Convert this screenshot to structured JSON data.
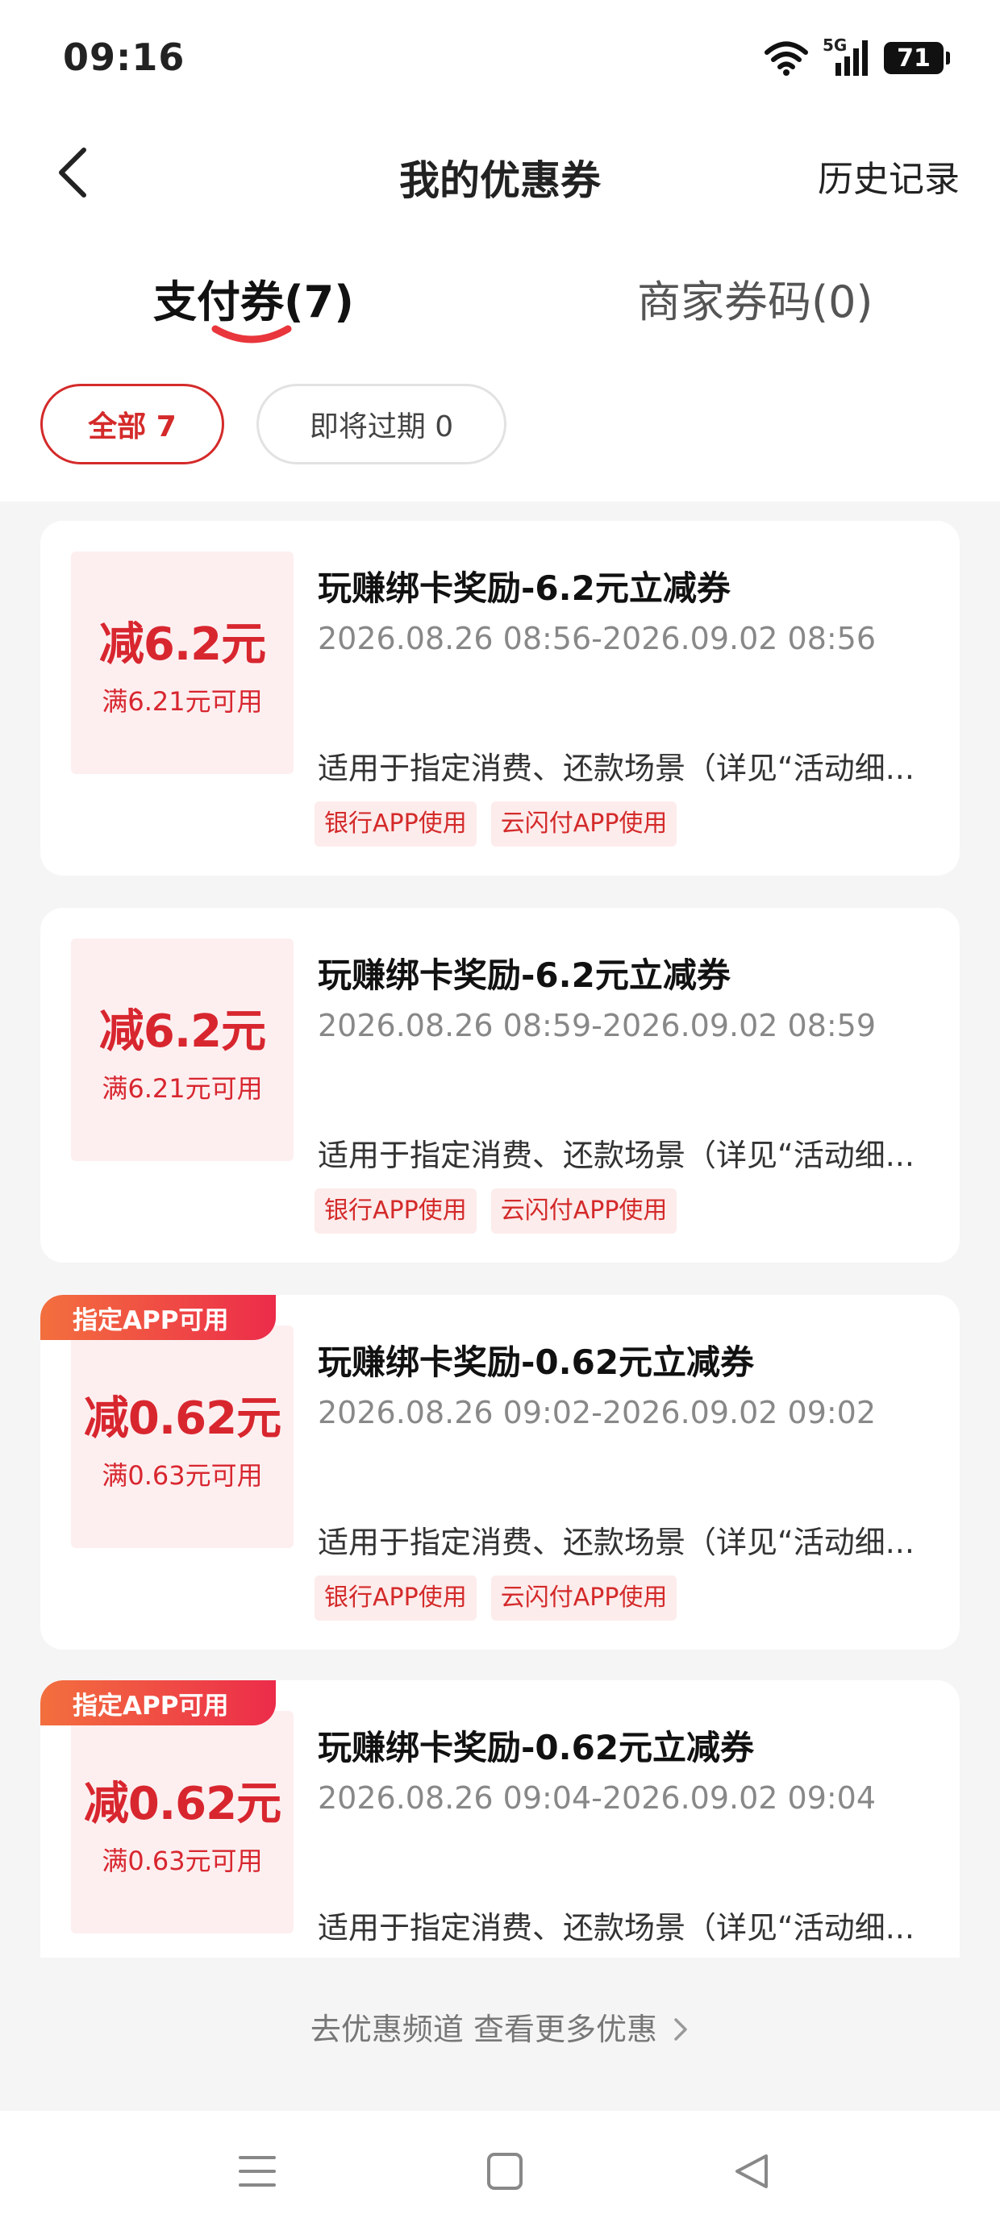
{
  "status": {
    "time": "09:16",
    "network": "5G",
    "battery": "71"
  },
  "header": {
    "title": "我的优惠券",
    "history": "历史记录"
  },
  "tabs": [
    {
      "label": "支付券(7)",
      "active": true
    },
    {
      "label": "商家券码(0)",
      "active": false
    }
  ],
  "filters": [
    {
      "label": "全部 7",
      "active": true
    },
    {
      "label": "即将过期 0",
      "active": false
    }
  ],
  "coupons": [
    {
      "ribbon": "",
      "amount": "减6.2元",
      "threshold": "满6.21元可用",
      "title": "玩赚绑卡奖励-6.2元立减券",
      "period": "2026.08.26 08:56-2026.09.02 08:56",
      "description": "适用于指定消费、还款场景（详见“活动细...",
      "tags": [
        "银行APP使用",
        "云闪付APP使用"
      ]
    },
    {
      "ribbon": "",
      "amount": "减6.2元",
      "threshold": "满6.21元可用",
      "title": "玩赚绑卡奖励-6.2元立减券",
      "period": "2026.08.26 08:59-2026.09.02 08:59",
      "description": "适用于指定消费、还款场景（详见“活动细...",
      "tags": [
        "银行APP使用",
        "云闪付APP使用"
      ]
    },
    {
      "ribbon": "指定APP可用",
      "amount": "减0.62元",
      "threshold": "满0.63元可用",
      "title": "玩赚绑卡奖励-0.62元立减券",
      "period": "2026.08.26 09:02-2026.09.02 09:02",
      "description": "适用于指定消费、还款场景（详见“活动细...",
      "tags": [
        "银行APP使用",
        "云闪付APP使用"
      ]
    },
    {
      "ribbon": "指定APP可用",
      "amount": "减0.62元",
      "threshold": "满0.63元可用",
      "title": "玩赚绑卡奖励-0.62元立减券",
      "period": "2026.08.26 09:04-2026.09.02 09:04",
      "description": "适用于指定消费、还款场景（详见“活动细...",
      "tags": []
    }
  ],
  "footer": {
    "more_link": "去优惠频道 查看更多优惠"
  },
  "colors": {
    "accent": "#d42a2a",
    "coupon_bg": "#fdeff0",
    "ribbon_start": "#f36f3e",
    "ribbon_end": "#ec2c4a"
  },
  "icons": {
    "back": "chevron-left-icon",
    "nav_menu": "menu-icon",
    "nav_home": "square-icon",
    "nav_back": "triangle-back-icon"
  }
}
